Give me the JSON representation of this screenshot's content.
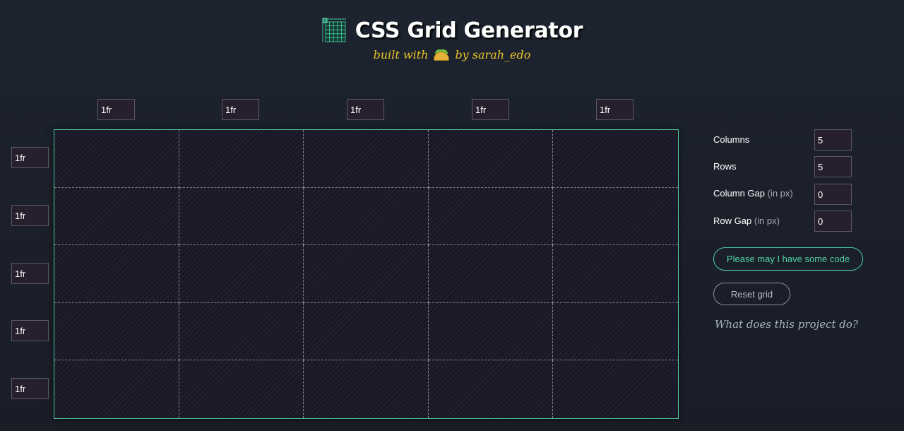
{
  "header": {
    "title": "CSS Grid Generator",
    "subtitle_prefix": "built with",
    "subtitle_icon": "taco-icon",
    "subtitle_suffix": "by sarah_edo"
  },
  "grid": {
    "columns": [
      "1fr",
      "1fr",
      "1fr",
      "1fr",
      "1fr"
    ],
    "rows": [
      "1fr",
      "1fr",
      "1fr",
      "1fr",
      "1fr"
    ],
    "accent_color": "#4fd1a5"
  },
  "controls": {
    "columns": {
      "label": "Columns",
      "value": "5"
    },
    "rows": {
      "label": "Rows",
      "value": "5"
    },
    "column_gap": {
      "label": "Column Gap",
      "hint": "(in px)",
      "value": "0"
    },
    "row_gap": {
      "label": "Row Gap",
      "hint": "(in px)",
      "value": "0"
    }
  },
  "buttons": {
    "code": "Please may I have some code",
    "reset": "Reset grid"
  },
  "about_link": "What does this project do?"
}
